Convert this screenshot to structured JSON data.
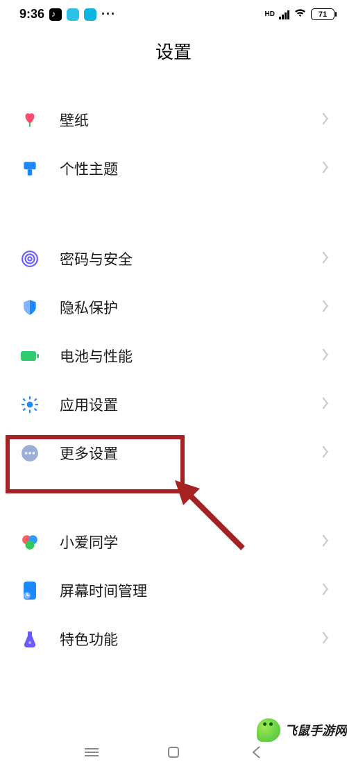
{
  "statusbar": {
    "time": "9:36",
    "more": "···",
    "hd": "HD",
    "battery": "71"
  },
  "header": {
    "title": "设置"
  },
  "groups": [
    {
      "items": [
        {
          "key": "wallpaper",
          "label": "壁纸"
        },
        {
          "key": "themes",
          "label": "个性主题"
        }
      ]
    },
    {
      "items": [
        {
          "key": "password_security",
          "label": "密码与安全"
        },
        {
          "key": "privacy",
          "label": "隐私保护"
        },
        {
          "key": "battery_perf",
          "label": "电池与性能"
        },
        {
          "key": "app_settings",
          "label": "应用设置"
        },
        {
          "key": "more_settings",
          "label": "更多设置"
        }
      ]
    },
    {
      "items": [
        {
          "key": "xiaoai",
          "label": "小爱同学"
        },
        {
          "key": "screen_time",
          "label": "屏幕时间管理"
        },
        {
          "key": "special_features",
          "label": "特色功能"
        }
      ]
    }
  ],
  "watermark": {
    "text": "飞鼠手游网"
  }
}
